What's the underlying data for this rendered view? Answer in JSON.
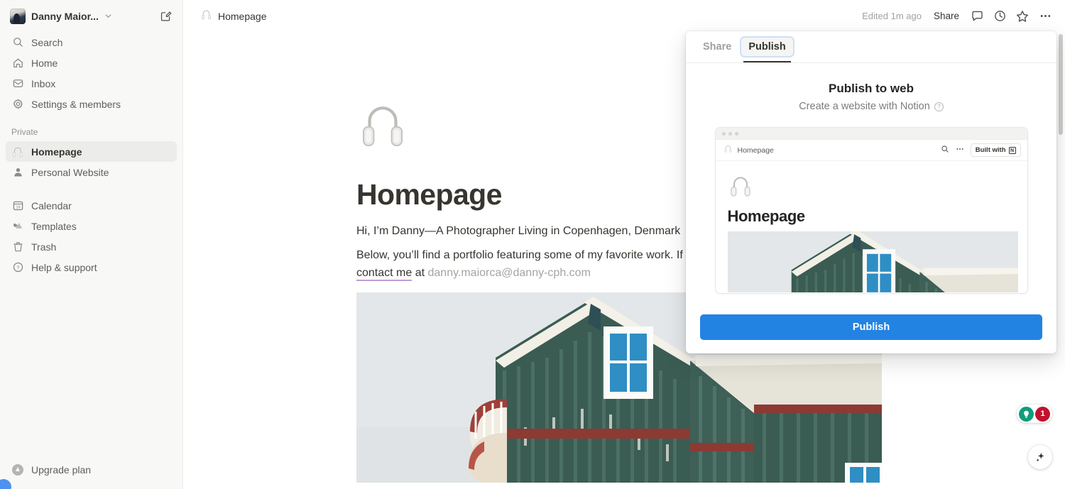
{
  "sidebar": {
    "workspace": {
      "name": "Danny Maior...",
      "avatar_icon": "workspace-avatar",
      "chevron_icon": "chevron-down-icon",
      "compose_icon": "compose-icon"
    },
    "nav_primary": [
      {
        "label": "Search",
        "icon": "search-icon"
      },
      {
        "label": "Home",
        "icon": "home-icon"
      },
      {
        "label": "Inbox",
        "icon": "inbox-icon"
      },
      {
        "label": "Settings & members",
        "icon": "gear-icon"
      }
    ],
    "private_section_label": "Private",
    "private_items": [
      {
        "label": "Homepage",
        "icon": "headphones-icon",
        "active": true
      },
      {
        "label": "Personal Website",
        "icon": "person-icon",
        "active": false
      }
    ],
    "nav_secondary": [
      {
        "label": "Calendar",
        "icon": "calendar-icon"
      },
      {
        "label": "Templates",
        "icon": "templates-icon"
      },
      {
        "label": "Trash",
        "icon": "trash-icon"
      },
      {
        "label": "Help & support",
        "icon": "question-circle-icon"
      }
    ],
    "upgrade": {
      "label": "Upgrade plan",
      "icon": "upgrade-arrow-icon"
    }
  },
  "topbar": {
    "breadcrumb_icon": "headphones-icon",
    "breadcrumb_title": "Homepage",
    "edited_status": "Edited 1m ago",
    "share_label": "Share",
    "comment_icon": "comment-icon",
    "history_icon": "clock-icon",
    "favorite_icon": "star-icon",
    "more_icon": "more-horizontal-icon"
  },
  "page": {
    "icon": "headphones-icon",
    "title": "Homepage",
    "paragraph_1": "Hi, I’m Danny—A Photographer Living in Copenhagen, Denmark",
    "paragraph_2_prefix": "Below, you’ll find a portfolio featuring some of my favorite work. If you’d like to work together, ",
    "paragraph_2_link": "please contact me",
    "paragraph_2_mid": " at ",
    "paragraph_2_email": "danny.maiorca@danny-cph.com",
    "cover_alt": "green-wooden-house-photo"
  },
  "publish_dialog": {
    "tabs": [
      {
        "label": "Share",
        "selected": false
      },
      {
        "label": "Publish",
        "selected": true
      }
    ],
    "title": "Publish to web",
    "subtitle": "Create a website with Notion",
    "help_icon": "question-circle-icon",
    "preview": {
      "nav_icon": "headphones-icon",
      "nav_title": "Homepage",
      "search_icon": "search-icon",
      "more_icon": "more-horizontal-icon",
      "built_with_label": "Built with",
      "built_with_icon": "notion-logo-icon",
      "page_icon": "headphones-icon",
      "page_title": "Homepage",
      "cover_alt": "green-wooden-house-photo"
    },
    "publish_button_label": "Publish"
  },
  "floating": {
    "help_icon": "lightbulb-icon",
    "help_badge_count": "1",
    "ai_icon": "sparkle-icon"
  },
  "colors": {
    "accent_blue": "#2383e2",
    "sidebar_bg": "#f8f8f7",
    "text_primary": "#37352f",
    "text_muted": "#9b9a97",
    "badge_red": "#c0122f",
    "bulb_green": "#0f9d7a",
    "link_underline": "#c39bd8",
    "tab_focus_ring": "#cfe0f7"
  }
}
